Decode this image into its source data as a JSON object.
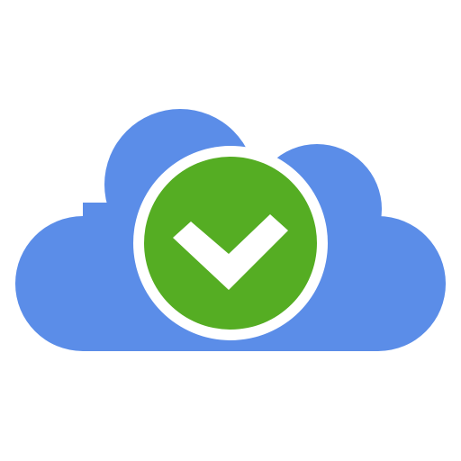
{
  "icon": {
    "name": "cloud-sync-check-icon",
    "colors": {
      "cloud": "#5b8de8",
      "badge_outer": "#ffffff",
      "badge_fill": "#55ad23",
      "check": "#ffffff"
    }
  }
}
